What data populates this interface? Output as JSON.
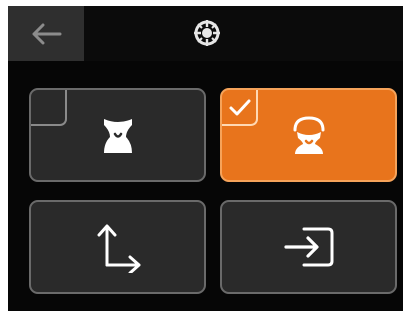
{
  "header": {
    "back_icon": "arrow-left-icon",
    "logo_icon": "crosshair-logo-icon"
  },
  "tiles": [
    {
      "id": "mode-a",
      "icon": "nozzle-cleaning-icon",
      "selected": false
    },
    {
      "id": "mode-b",
      "icon": "nozzle-wiping-icon",
      "selected": true,
      "check_icon": "checkmark-icon"
    },
    {
      "id": "axes",
      "icon": "axes-move-icon",
      "selected": false
    },
    {
      "id": "import",
      "icon": "import-enter-icon",
      "selected": false
    }
  ],
  "colors": {
    "accent": "#e8741c",
    "tile_bg": "#2a2a2a",
    "tile_border": "#6a6a6a",
    "screen_bg": "#060606",
    "back_bg": "#2f2f2f"
  }
}
